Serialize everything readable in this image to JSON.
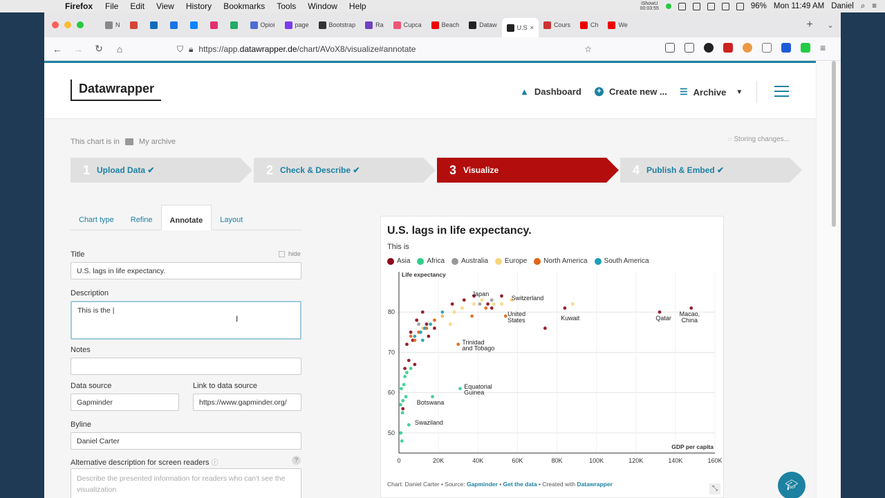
{
  "mac": {
    "app": "Firefox",
    "menus": [
      "File",
      "Edit",
      "View",
      "History",
      "Bookmarks",
      "Tools",
      "Window",
      "Help"
    ],
    "recorder_top": "iShowU",
    "recorder_time": "00:03:55",
    "battery": "96%",
    "clock": "Mon 11:49 AM",
    "user": "Daniel"
  },
  "browser": {
    "tabs": [
      {
        "label": "N",
        "color": "#888"
      },
      {
        "label": "",
        "color": "#d44638"
      },
      {
        "label": "",
        "color": "#0f6cbd"
      },
      {
        "label": "",
        "color": "#1a73e8"
      },
      {
        "label": "",
        "color": "#0a84ff"
      },
      {
        "label": "",
        "color": "#e1306c"
      },
      {
        "label": "",
        "color": "#2a6"
      },
      {
        "label": "Opioi",
        "color": "#4a6fd0"
      },
      {
        "label": "page",
        "color": "#7c3aed"
      },
      {
        "label": "Bootstrap",
        "color": "#333"
      },
      {
        "label": "Ra",
        "color": "#6f42c1"
      },
      {
        "label": "Cupca",
        "color": "#e57"
      },
      {
        "label": "Beach",
        "color": "#e00"
      },
      {
        "label": "Dataw",
        "color": "#222"
      },
      {
        "label": "U.S",
        "color": "#222"
      },
      {
        "label": "Cours",
        "color": "#c33"
      },
      {
        "label": "Ch",
        "color": "#e00"
      },
      {
        "label": "We",
        "color": "#e00"
      }
    ],
    "url_prefix": "https://app.",
    "url_host": "datawrapper.de",
    "url_path": "/chart/AVoX8/visualize#annotate"
  },
  "header": {
    "logo": "Datawrapper",
    "dashboard": "Dashboard",
    "create_new": "Create new ...",
    "archive": "Archive"
  },
  "breadcrumb": {
    "prefix": "This chart is in",
    "folder": "My archive"
  },
  "status": "Storing changes...",
  "steps": [
    {
      "num": "1",
      "label": "Upload Data ✔"
    },
    {
      "num": "2",
      "label": "Check & Describe ✔"
    },
    {
      "num": "3",
      "label": "Visualize"
    },
    {
      "num": "4",
      "label": "Publish & Embed ✔"
    }
  ],
  "subtabs": [
    "Chart type",
    "Refine",
    "Annotate",
    "Layout"
  ],
  "form": {
    "title_label": "Title",
    "hide_label": "hide",
    "title_value": "U.S. lags in life expectancy.",
    "desc_label": "Description",
    "desc_value": "This is the |",
    "notes_label": "Notes",
    "notes_value": "",
    "source_label": "Data source",
    "source_value": "Gapminder",
    "link_label": "Link to data source",
    "link_value": "https://www.gapminder.org/",
    "byline_label": "Byline",
    "byline_value": "Daniel Carter",
    "alt_label": "Alternative description for screen readers",
    "alt_placeholder": "Describe the presented information for readers who can't see the visualization"
  },
  "chart_data": {
    "type": "scatter",
    "title": "U.S. lags in life expectancy.",
    "description": "This is",
    "ylabel": "Life expectancy",
    "xlabel": "GDP per capita",
    "xlim": [
      0,
      160000
    ],
    "ylim": [
      45,
      90
    ],
    "xticks": [
      {
        "v": 0,
        "l": "0"
      },
      {
        "v": 20000,
        "l": "20K"
      },
      {
        "v": 40000,
        "l": "40K"
      },
      {
        "v": 60000,
        "l": "60K"
      },
      {
        "v": 80000,
        "l": "80K"
      },
      {
        "v": 100000,
        "l": "100K"
      },
      {
        "v": 120000,
        "l": "120K"
      },
      {
        "v": 140000,
        "l": "140K"
      },
      {
        "v": 160000,
        "l": "160K"
      }
    ],
    "yticks": [
      50,
      60,
      70,
      80
    ],
    "series": [
      {
        "name": "Asia",
        "color": "#8b0a1a",
        "points": [
          [
            2000,
            56
          ],
          [
            3000,
            66
          ],
          [
            4000,
            72
          ],
          [
            6000,
            75
          ],
          [
            7000,
            73
          ],
          [
            9000,
            78
          ],
          [
            12000,
            80
          ],
          [
            15000,
            74
          ],
          [
            18000,
            76
          ],
          [
            22000,
            79
          ],
          [
            27000,
            82
          ],
          [
            33000,
            83
          ],
          [
            38000,
            84
          ],
          [
            45000,
            82
          ],
          [
            47000,
            81
          ],
          [
            52000,
            84
          ],
          [
            74000,
            76
          ],
          [
            84000,
            81
          ],
          [
            132000,
            80
          ],
          [
            148000,
            81
          ],
          [
            5000,
            68
          ],
          [
            8000,
            67
          ],
          [
            14000,
            77
          ]
        ]
      },
      {
        "name": "Africa",
        "color": "#2ecf8a",
        "points": [
          [
            1000,
            50
          ],
          [
            1500,
            48
          ],
          [
            2000,
            58
          ],
          [
            2500,
            62
          ],
          [
            3000,
            64
          ],
          [
            1200,
            61
          ],
          [
            1800,
            55
          ],
          [
            4000,
            65
          ],
          [
            6000,
            66
          ],
          [
            800,
            57
          ],
          [
            3500,
            59
          ],
          [
            17000,
            59
          ],
          [
            31000,
            61
          ],
          [
            5000,
            52
          ]
        ]
      },
      {
        "name": "Australia",
        "color": "#999999",
        "points": [
          [
            10000,
            77
          ],
          [
            47000,
            83
          ],
          [
            41000,
            82
          ]
        ]
      },
      {
        "name": "Europe",
        "color": "#f7d67a",
        "points": [
          [
            12000,
            76
          ],
          [
            18000,
            78
          ],
          [
            22000,
            79
          ],
          [
            28000,
            80
          ],
          [
            32000,
            81
          ],
          [
            38000,
            82
          ],
          [
            42000,
            83
          ],
          [
            48000,
            82
          ],
          [
            52000,
            82
          ],
          [
            57000,
            83
          ],
          [
            88000,
            82
          ],
          [
            26000,
            77
          ]
        ]
      },
      {
        "name": "North America",
        "color": "#e06614",
        "points": [
          [
            6000,
            74
          ],
          [
            10000,
            75
          ],
          [
            14000,
            76
          ],
          [
            18000,
            78
          ],
          [
            30000,
            72
          ],
          [
            44000,
            81
          ],
          [
            8000,
            73
          ],
          [
            37000,
            79
          ],
          [
            54000,
            79
          ]
        ]
      },
      {
        "name": "South America",
        "color": "#1aa0b8",
        "points": [
          [
            8000,
            74
          ],
          [
            11000,
            75
          ],
          [
            13000,
            76
          ],
          [
            16000,
            77
          ],
          [
            22000,
            80
          ],
          [
            12000,
            73
          ]
        ]
      }
    ],
    "annotations": [
      {
        "text": "Japan",
        "x": 37000,
        "y": 84
      },
      {
        "text": "Switzerland",
        "x": 57000,
        "y": 83
      },
      {
        "text": "United",
        "x": 55000,
        "y": 79
      },
      {
        "text": "States",
        "x": 55000,
        "y": 77.5
      },
      {
        "text": "Kuwait",
        "x": 82000,
        "y": 78
      },
      {
        "text": "Qatar",
        "x": 130000,
        "y": 78
      },
      {
        "text": "Macao,",
        "x": 142000,
        "y": 79
      },
      {
        "text": "China",
        "x": 143000,
        "y": 77.5
      },
      {
        "text": "Trinidad",
        "x": 32000,
        "y": 72
      },
      {
        "text": "and Tobago",
        "x": 32000,
        "y": 70.5
      },
      {
        "text": "Equatorial",
        "x": 33000,
        "y": 61
      },
      {
        "text": "Guinea",
        "x": 33000,
        "y": 59.5
      },
      {
        "text": "Botswana",
        "x": 9000,
        "y": 57
      },
      {
        "text": "Swaziland",
        "x": 8000,
        "y": 52
      }
    ],
    "footer": {
      "prefix": "Chart: Daniel Carter • Source: ",
      "source": "Gapminder",
      "sep": " • ",
      "get": "Get the data",
      "created": " • Created with ",
      "tool": "Datawrapper"
    },
    "legend_position": "top-left",
    "grid": true
  },
  "colors": {
    "accent": "#1d81a2",
    "active_step": "#b30d0d"
  }
}
